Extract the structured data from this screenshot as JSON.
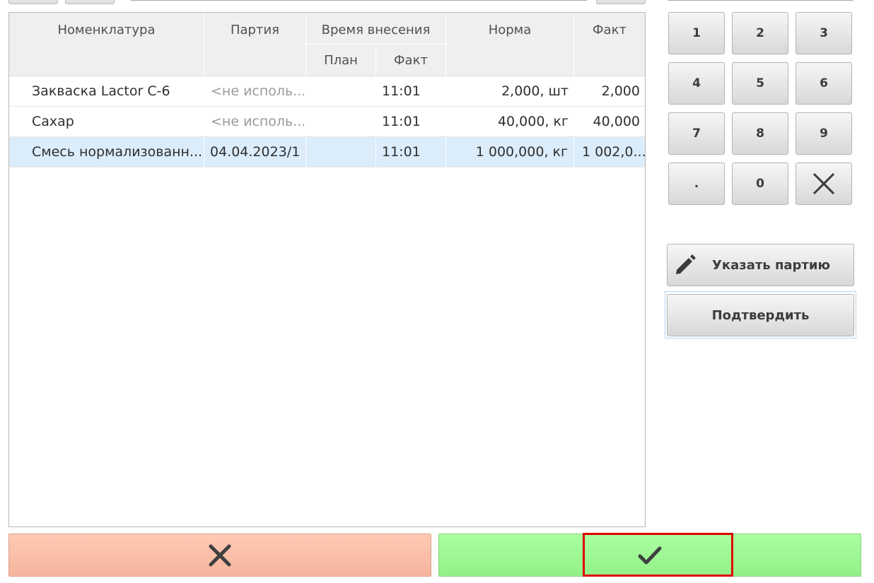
{
  "table": {
    "headers": {
      "nomenclature": "Номенклатура",
      "batch": "Партия",
      "time_group": "Время внесения",
      "plan": "План",
      "fact_time": "Факт",
      "norm": "Норма",
      "fact": "Факт"
    },
    "rows": [
      {
        "name": "Закваска Lactor C-6",
        "batch": "<не исполь...",
        "plan": "",
        "fact_time": "11:01",
        "norm": "2,000, шт",
        "fact": "2,000",
        "selected": false
      },
      {
        "name": "Сахар",
        "batch": "<не исполь...",
        "plan": "",
        "fact_time": "11:01",
        "norm": "40,000, кг",
        "fact": "40,000",
        "selected": false
      },
      {
        "name": "Смесь нормализованн...",
        "batch": "04.04.2023/1",
        "plan": "",
        "fact_time": "11:01",
        "norm": "1 000,000, кг",
        "fact": "1 002,0...",
        "selected": true
      }
    ]
  },
  "keypad": {
    "keys": [
      "1",
      "2",
      "3",
      "4",
      "5",
      "6",
      "7",
      "8",
      "9",
      ".",
      "0"
    ],
    "clear_icon": "close-icon"
  },
  "actions": {
    "specify_batch_label": "Указать партию",
    "specify_batch_icon": "pencil-icon",
    "confirm_label": "Подтвердить"
  },
  "bottom": {
    "cancel_icon": "close-icon",
    "ok_icon": "check-icon"
  },
  "colors": {
    "cancel": "#f9bca4",
    "ok": "#9ef894",
    "selected_row": "#dbecfa",
    "highlight": "#e00000"
  }
}
